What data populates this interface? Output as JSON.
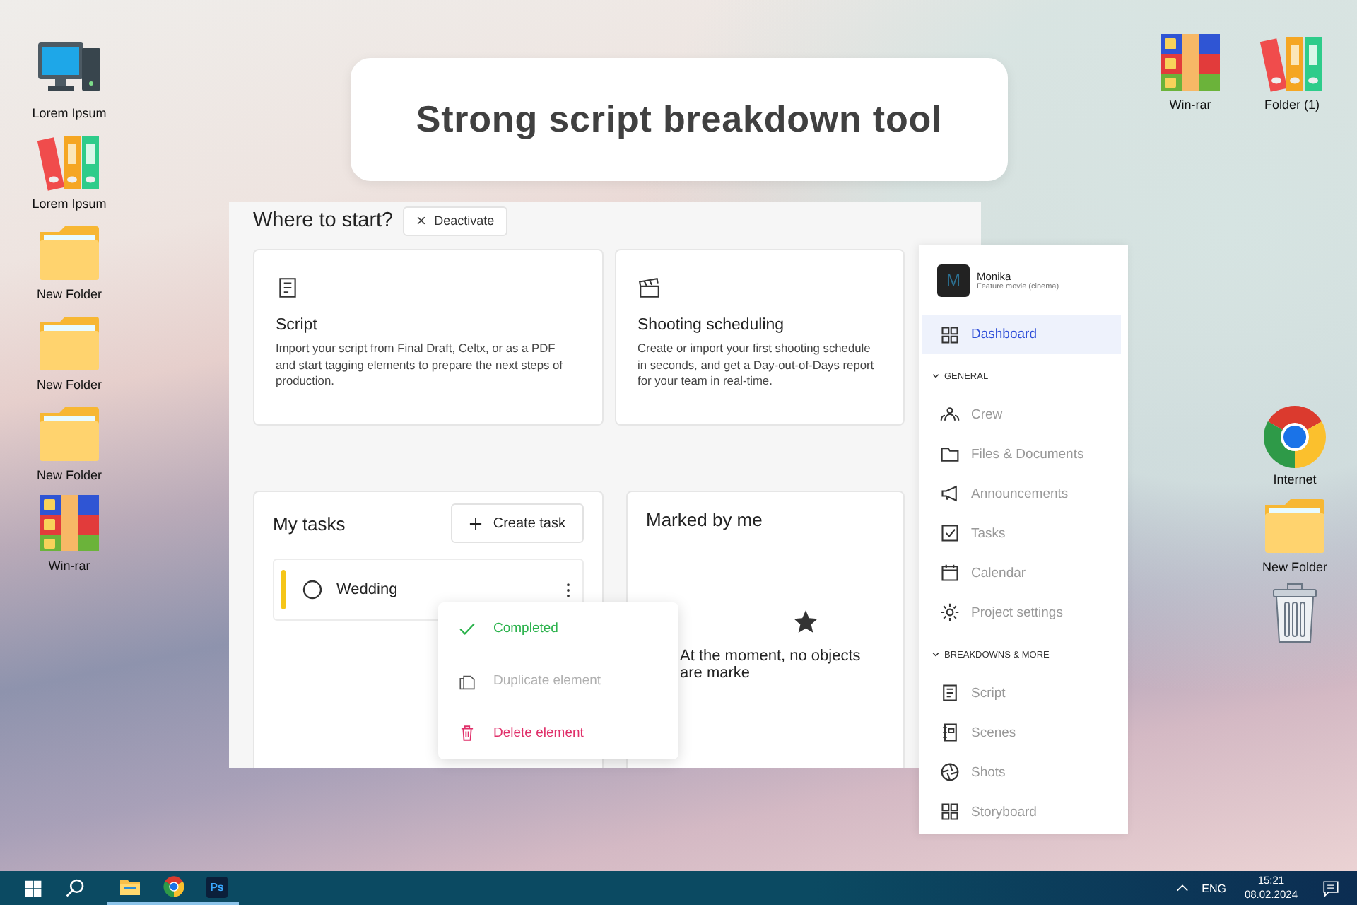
{
  "desktop": {
    "left_icons": [
      {
        "kind": "computer",
        "label": "Lorem Ipsum"
      },
      {
        "kind": "binders",
        "label": "Lorem Ipsum"
      },
      {
        "kind": "folder",
        "label": "New Folder"
      },
      {
        "kind": "folder",
        "label": "New Folder"
      },
      {
        "kind": "folder",
        "label": "New Folder"
      },
      {
        "kind": "archive",
        "label": "Win-rar"
      }
    ],
    "top_right_icons": [
      {
        "kind": "archive",
        "label": "Win-rar"
      },
      {
        "kind": "binders",
        "label": "Folder (1)"
      }
    ],
    "right_icons": [
      {
        "kind": "browser",
        "label": "Internet"
      },
      {
        "kind": "folder",
        "label": "New Folder"
      },
      {
        "kind": "trash"
      }
    ]
  },
  "banner": {
    "title": "Strong script breakdown tool"
  },
  "app": {
    "heading": "Where to start?",
    "deactivate_button": "Deactivate",
    "start_cards": [
      {
        "title": "Script",
        "description": "Import your script from Final Draft, Celtx, or as a PDF and start tagging elements to prepare the next steps of production."
      },
      {
        "title": "Shooting scheduling",
        "description": "Create or import your first shooting schedule in seconds, and get a Day-out-of-Days report for your team in real-time."
      }
    ],
    "my_tasks": {
      "title": "My tasks",
      "create_button": "Create task",
      "tasks": [
        {
          "name": "Wedding",
          "done": false,
          "color": "#f5c518"
        }
      ]
    },
    "task_menu": [
      {
        "label": "Completed",
        "color": "#2bb24c"
      },
      {
        "label": "Duplicate element",
        "color": "#b0b0b0"
      },
      {
        "label": "Delete element",
        "color": "#e0306a"
      }
    ],
    "marked": {
      "title": "Marked by me",
      "empty_message": "At the moment, no objects are marke"
    }
  },
  "sidebar": {
    "avatar_letter": "M",
    "project": "Monika",
    "project_type": "Feature movie (cinema)",
    "items": [
      {
        "label": "Dashboard",
        "selected": true
      }
    ],
    "sections": [
      {
        "title": "GENERAL",
        "items": [
          {
            "label": "Crew",
            "selected": false
          },
          {
            "label": "Files & Documents",
            "selected": false
          },
          {
            "label": "Announcements",
            "selected": false
          },
          {
            "label": "Tasks",
            "selected": false
          },
          {
            "label": "Calendar",
            "selected": false
          },
          {
            "label": "Project settings",
            "selected": false
          }
        ]
      },
      {
        "title": "BREAKDOWNS & MORE",
        "items": [
          {
            "label": "Script",
            "selected": false
          },
          {
            "label": "Scenes",
            "selected": false
          },
          {
            "label": "Shots",
            "selected": false
          },
          {
            "label": "Storyboard",
            "selected": false
          }
        ]
      }
    ]
  },
  "taskbar": {
    "apps": [
      {
        "kind": "explorer",
        "running": true
      },
      {
        "kind": "browser",
        "running": true
      },
      {
        "kind": "photoshop",
        "label": "Ps",
        "running": true
      }
    ],
    "language": "ENG",
    "time": "15:21",
    "date": "08.02.2024"
  }
}
